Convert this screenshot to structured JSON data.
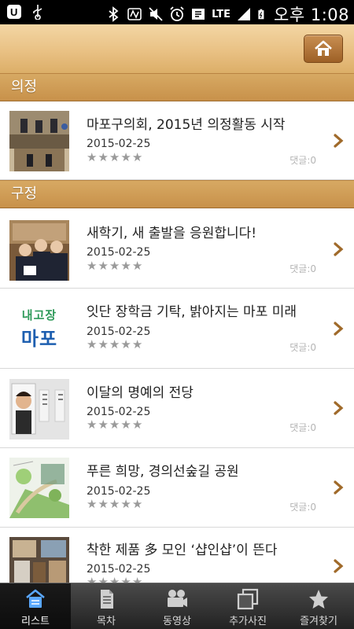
{
  "status_bar": {
    "network": "LTE",
    "time": "오후 1:08"
  },
  "sections": [
    {
      "title": "의정",
      "items": [
        {
          "title": "마포구의회, 2015년 의정활동 시작",
          "date": "2015-02-25",
          "comments": "댓글:0",
          "rating": 0
        }
      ]
    },
    {
      "title": "구정",
      "items": [
        {
          "title": "새학기, 새 출발을 응원합니다!",
          "date": "2015-02-25",
          "comments": "댓글:0",
          "rating": 0
        },
        {
          "title": "잇단 장학금 기탁, 밝아지는 마포 미래",
          "date": "2015-02-25",
          "comments": "댓글:0",
          "rating": 0,
          "thumb_line1": "내고장",
          "thumb_line2": "마포"
        },
        {
          "title": "이달의 명예의 전당",
          "date": "2015-02-25",
          "comments": "댓글:0",
          "rating": 0
        },
        {
          "title": "푸른 희망, 경의선숲길 공원",
          "date": "2015-02-25",
          "comments": "댓글:0",
          "rating": 0
        },
        {
          "title": "착한 제품 多 모인 ‘샵인샵’이 뜬다",
          "date": "2015-02-25",
          "comments": "",
          "rating": 0
        }
      ]
    }
  ],
  "tabs": [
    {
      "label": "리스트",
      "icon": "list-home-icon",
      "active": true
    },
    {
      "label": "목차",
      "icon": "document-icon",
      "active": false
    },
    {
      "label": "동영상",
      "icon": "video-camera-icon",
      "active": false
    },
    {
      "label": "추가사진",
      "icon": "photos-icon",
      "active": false
    },
    {
      "label": "즐겨찾기",
      "icon": "star-icon",
      "active": false
    }
  ],
  "colors": {
    "accent": "#c8914a",
    "section_text": "#ffffff",
    "chevron": "#a06a2a"
  }
}
